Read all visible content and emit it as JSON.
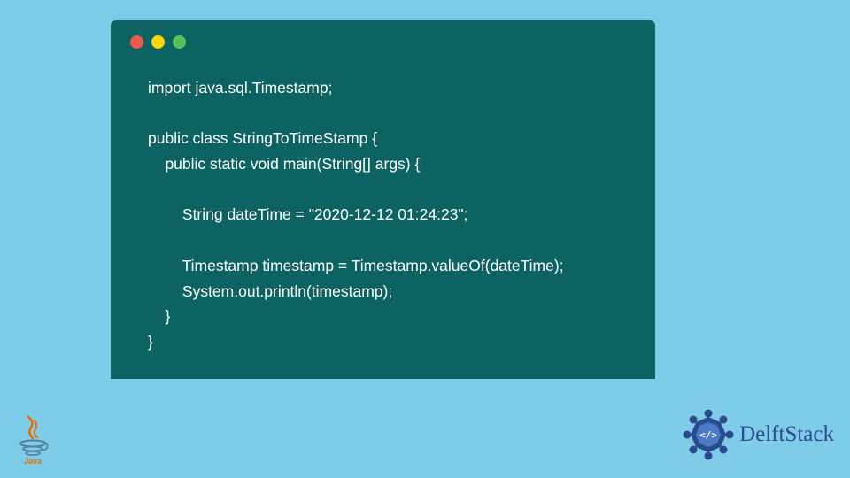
{
  "code": {
    "line1": "import java.sql.Timestamp;",
    "line2": "",
    "line3": "public class StringToTimeStamp {",
    "line4": "    public static void main(String[] args) {",
    "line5": "",
    "line6": "        String dateTime = \"2020-12-12 01:24:23\";",
    "line7": "",
    "line8": "        Timestamp timestamp = Timestamp.valueOf(dateTime);",
    "line9": "        System.out.println(timestamp);",
    "line10": "    }",
    "line11": "}"
  },
  "branding": {
    "delftstack": "DelftStack",
    "java": "Java"
  }
}
